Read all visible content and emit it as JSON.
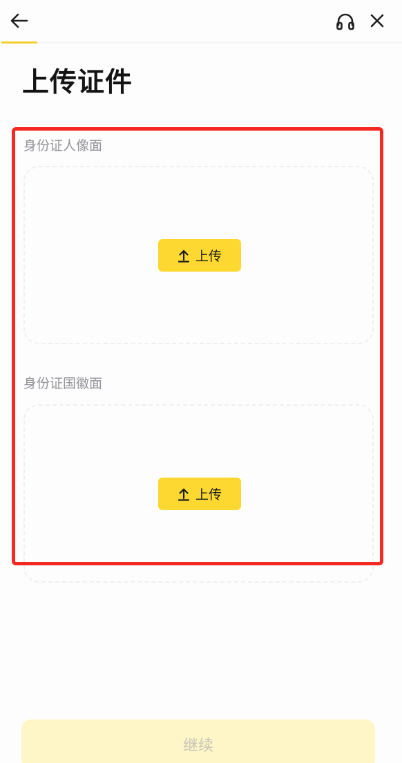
{
  "header": {
    "back_icon": "arrow-left-icon",
    "support_icon": "headset-icon",
    "close_icon": "close-icon",
    "progress": 0.09,
    "accent_color": "#f5cf2c"
  },
  "page": {
    "title": "上传证件"
  },
  "sections": [
    {
      "label": "身份证人像面",
      "upload_label": "上传",
      "upload_icon": "upload-arrow-icon"
    },
    {
      "label": "身份证国徽面",
      "upload_label": "上传",
      "upload_icon": "upload-arrow-icon"
    }
  ],
  "footer": {
    "continue_label": "继续"
  },
  "colors": {
    "upload_button": "#fcd831",
    "continue_disabled": "#fff6c7",
    "highlight": "#f42a22"
  }
}
